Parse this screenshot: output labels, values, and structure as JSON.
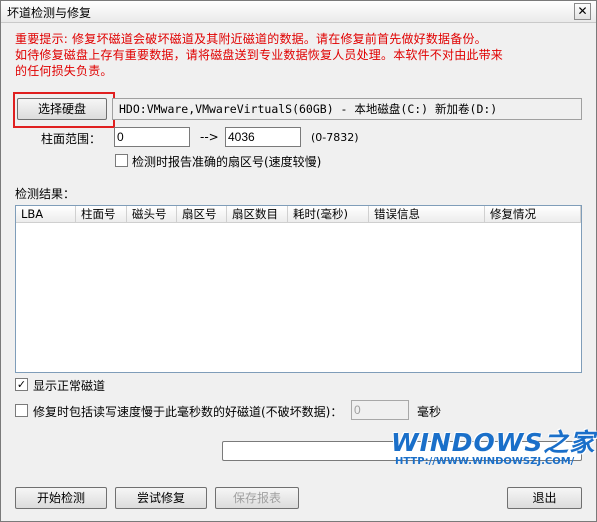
{
  "window": {
    "title": "坏道检测与修复",
    "close_symbol": "✕"
  },
  "warning": {
    "lines": [
      "重要提示: 修复坏磁道会破坏磁道及其附近磁道的数据。请在修复前首先做好数据备份。",
      "如待修复磁盘上存有重要数据，请将磁盘送到专业数据恢复人员处理。本软件不对由此带来",
      "的任何损失负责。"
    ]
  },
  "disk": {
    "select_label": "选择硬盘",
    "info": "HDO:VMware,VMwareVirtualS(60GB) - 本地磁盘(C:) 新加卷(D:)"
  },
  "range": {
    "label": "柱面范围：",
    "start": "0",
    "arrow": "-->",
    "end": "4036",
    "hint": "(0-7832)"
  },
  "report_exact_sector": {
    "label": "检测时报告准确的扇区号(速度较慢)",
    "checked": false
  },
  "results": {
    "label": "检测结果：",
    "columns": [
      "LBA",
      "柱面号",
      "磁头号",
      "扇区号",
      "扇区数目",
      "耗时(毫秒)",
      "错误信息",
      "修复情况"
    ],
    "rows": []
  },
  "show_normal": {
    "label": "显示正常磁道",
    "checked": true
  },
  "repair_slow": {
    "label": "修复时包括读写速度慢于此毫秒数的好磁道(不破坏数据)：",
    "checked": false,
    "value": "0",
    "unit": "毫秒"
  },
  "progress": {
    "value": 0
  },
  "watermark": {
    "brand": "WINDOWS之家",
    "url": "HTTP://WWW.WINDOWSZJ.COM/"
  },
  "buttons": {
    "start": "开始检测",
    "try_repair": "尝试修复",
    "save_report": "保存报表",
    "exit": "退出"
  },
  "colors": {
    "warning": "#e00000",
    "highlight": "#e02020",
    "brand": "#1a6fc9"
  }
}
